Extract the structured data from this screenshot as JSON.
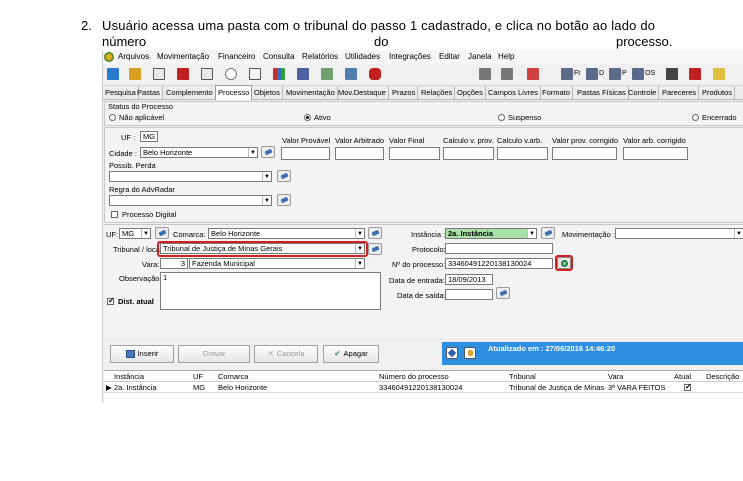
{
  "doc": {
    "step_number": "2.",
    "step_line1": "Usuário acessa uma pasta com o tribunal do passo 1 cadastrado, e clica no botão ao lado do",
    "step_line2_words": [
      "número",
      "do",
      "processo."
    ]
  },
  "menu": [
    "Arquivos",
    "Movimentação",
    "Financeiro",
    "Consulta",
    "Relatórios",
    "Utilidades",
    "Integrações",
    "Editar",
    "Janela",
    "Help"
  ],
  "toolbar": {
    "ft": "Ft",
    "d": "D",
    "p": "P",
    "os": "OS"
  },
  "tabs": [
    "Pesquisa",
    "Pastas",
    "Complemento",
    "Processo",
    "Objetos",
    "Movimentação",
    "Mov.Destaque",
    "Prazos",
    "Relações",
    "Opções",
    "Campos Livres",
    "Formato",
    "Pastas Físicas",
    "Controle",
    "Pareceres",
    "Produtos"
  ],
  "status": {
    "group_label": "Status do Processo",
    "options": [
      "Não aplicável",
      "Ativo",
      "Suspenso",
      "Encerrado"
    ],
    "selected": "Ativo"
  },
  "upper": {
    "uf_label": "UF :",
    "uf_value": "MG",
    "cidade_label": "Cidade :",
    "cidade_value": "Belo Horizonte",
    "possib_label": "Possib. Perda",
    "regra_label": "Regra do AdvRadar",
    "digital_label": "Processo Digital",
    "value_headers": [
      "Valor Provável",
      "Valor Arbitrado",
      "Valor Final",
      "Calculo v. prov.",
      "Calculo v.arb.",
      "Valor prov. corrigido",
      "Valor arb. corrigido"
    ]
  },
  "instance": {
    "uf_label": "UF:",
    "uf_value": "MG",
    "comarca_label": "Comarca:",
    "comarca_value": "Belo Horizonte",
    "tribunal_label": "Tribunal / local:",
    "tribunal_value": "Tribunal de Justiça de Minas Gerais",
    "vara_label": "Vara:",
    "vara_num": "3",
    "vara_value": "Fazenda Municipal",
    "obs_label": "Observação:",
    "obs_value": "1",
    "dist_label": "Dist. atual",
    "instancia_label": "Instância :",
    "instancia_value": "2a. Instância",
    "mov_label": "Movimentação :",
    "protocolo_label": "Protocolo:",
    "nprocesso_label": "Nº do processo:",
    "nprocesso_value": "3346049122013813002​4",
    "entrada_label": "Data de entrada:",
    "entrada_value": "18/09/2013",
    "saida_label": "Data de saída:"
  },
  "buttons": {
    "inserir": "Inserir",
    "gravar": "Gravar",
    "cancela": "Cancela",
    "apagar": "Apagar"
  },
  "updated": "Atualizado em : 27/06/2016 14:46:20",
  "grid": {
    "headers": [
      "Instância",
      "UF",
      "Comarca",
      "Número do processo",
      "Tribunal",
      "Vara",
      "Atual",
      "Descrição"
    ],
    "rows": [
      [
        "2a. Instância",
        "MG",
        "Belo Horizonte",
        "33460491220138130024",
        "Tribunal de Justiça de Minas",
        "3ª VARA FEITOS",
        "",
        ""
      ]
    ]
  }
}
